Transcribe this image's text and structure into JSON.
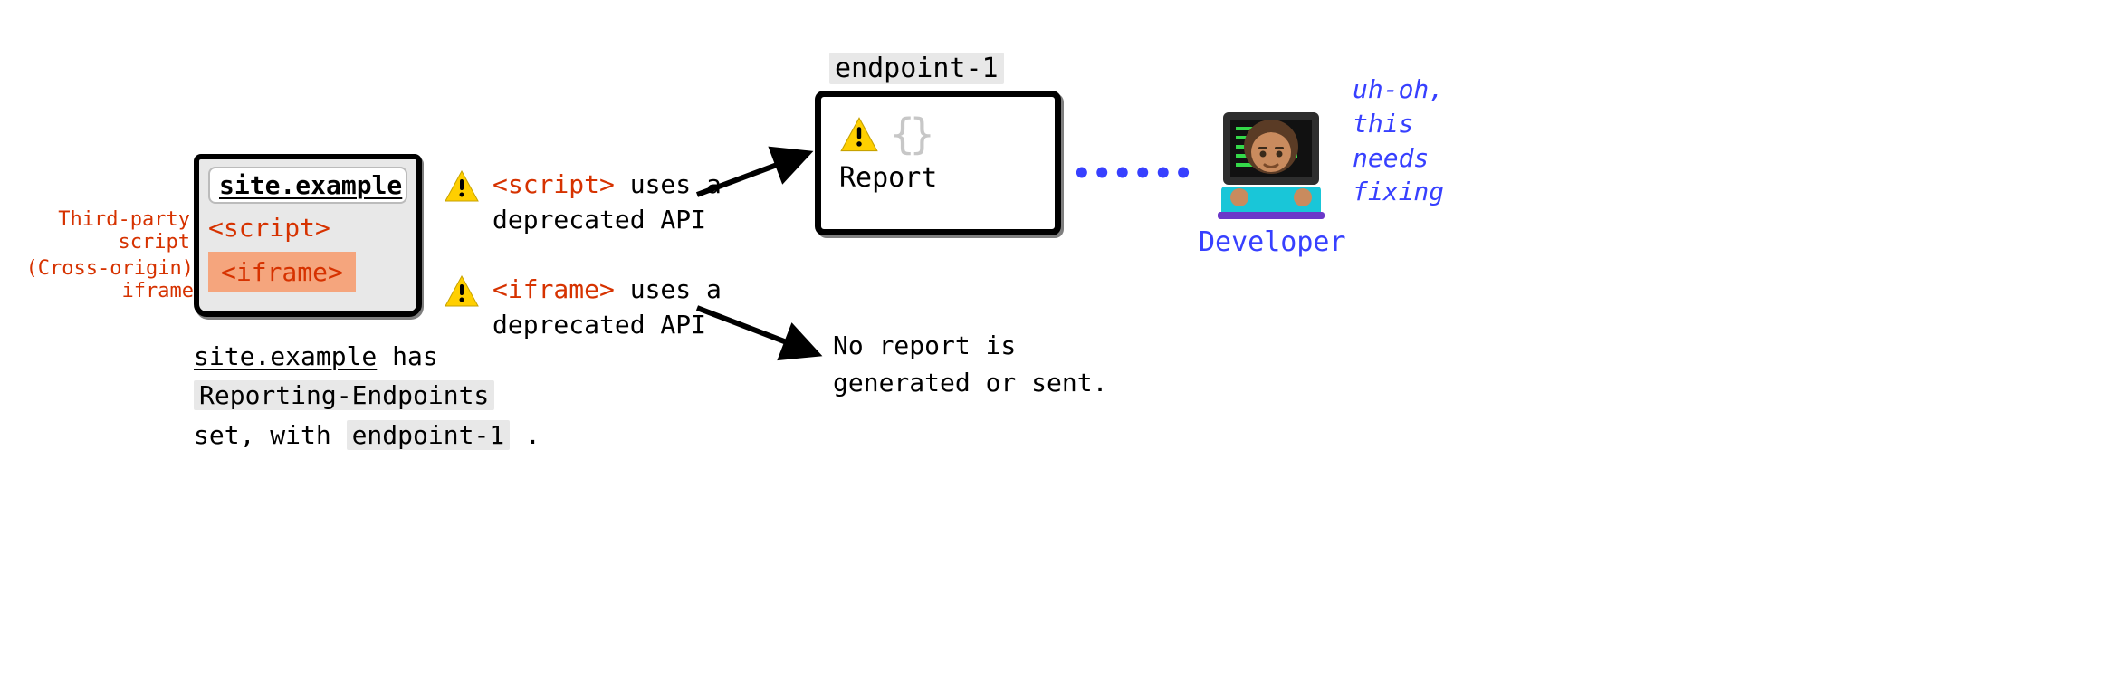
{
  "site": {
    "url": "site.example",
    "script_tag": "<script>",
    "iframe_tag": "<iframe>",
    "label_script": "Third-party script",
    "label_iframe": "(Cross-origin) iframe",
    "caption_pre": "site.example",
    "caption_mid1": " has ",
    "caption_header": "Reporting-Endpoints",
    "caption_mid2": " set, with ",
    "caption_endpoint": "endpoint-1",
    "caption_post": " ."
  },
  "messages": {
    "m1_code": "<script>",
    "m1_rest": " uses a deprecated API",
    "m2_code": "<iframe>",
    "m2_rest": " uses a deprecated API"
  },
  "endpoint": {
    "title": "endpoint-1",
    "braces": "{}",
    "report_label": "Report"
  },
  "no_report": "No report is generated or sent.",
  "developer": {
    "label": "Developer",
    "quote": "uh-oh, this needs fixing"
  },
  "icons": {
    "warning": "warning-icon",
    "braces": "braces-icon",
    "arrow_up": "arrow-to-endpoint",
    "arrow_down": "arrow-to-noreport"
  }
}
